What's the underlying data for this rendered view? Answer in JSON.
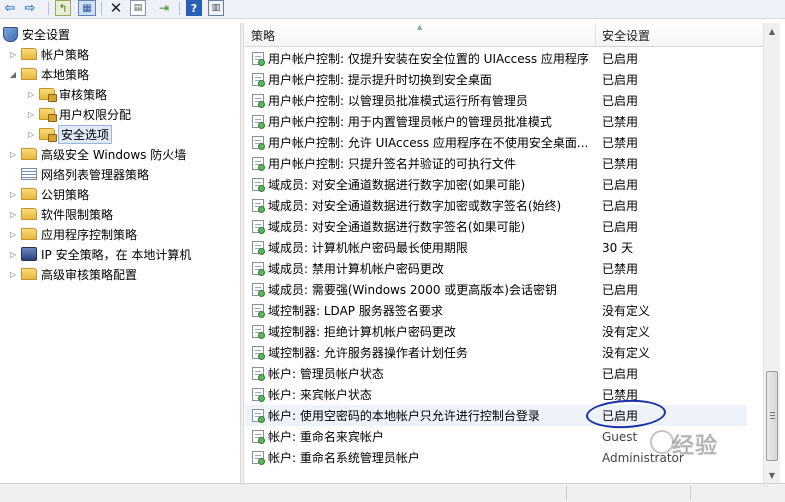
{
  "toolbar": {
    "icons": [
      "back-arrow-icon",
      "forward-arrow-icon",
      "up-folder-icon",
      "show-hide-tree-icon",
      "delete-icon",
      "properties-icon",
      "export-list-icon",
      "help-icon",
      "show-hide-action-pane-icon"
    ],
    "back_glyph": "⇦",
    "forward_glyph": "⇨",
    "up_glyph": "↰",
    "view_glyph": "▦",
    "delete_glyph": "✕",
    "properties_glyph": "▤",
    "export_glyph": "⇥",
    "help_glyph": "?",
    "panel_glyph": "▥"
  },
  "tree": {
    "nodes": [
      {
        "label": "安全设置",
        "icon": "security-settings-icon",
        "arrow": "◢",
        "expanded": true
      },
      {
        "label": "帐户策略",
        "icon": "folder-icon",
        "arrow": "▷"
      },
      {
        "label": "本地策略",
        "icon": "folder-icon",
        "arrow": "◢",
        "expanded": true
      },
      {
        "label": "审核策略",
        "icon": "locked-folder-icon",
        "arrow": "▷"
      },
      {
        "label": "用户权限分配",
        "icon": "locked-folder-icon",
        "arrow": "▷"
      },
      {
        "label": "安全选项",
        "icon": "locked-folder-icon",
        "arrow": "▷",
        "selected": true
      },
      {
        "label": "高级安全 Windows 防火墙",
        "icon": "folder-icon",
        "arrow": "▷"
      },
      {
        "label": "网络列表管理器策略",
        "icon": "network-list-icon",
        "arrow": ""
      },
      {
        "label": "公钥策略",
        "icon": "folder-icon",
        "arrow": "▷"
      },
      {
        "label": "软件限制策略",
        "icon": "folder-icon",
        "arrow": "▷"
      },
      {
        "label": "应用程序控制策略",
        "icon": "folder-icon",
        "arrow": "▷"
      },
      {
        "label": "IP 安全策略，在 本地计算机",
        "icon": "ip-security-icon",
        "arrow": "▷"
      },
      {
        "label": "高级审核策略配置",
        "icon": "folder-icon",
        "arrow": "▷"
      }
    ]
  },
  "list": {
    "headers": {
      "policy": "策略",
      "setting": "安全设置"
    },
    "sort_glyph": "▲",
    "rows": [
      {
        "policy": "用户帐户控制: 仅提升安装在安全位置的 UIAccess 应用程序",
        "setting": "已启用"
      },
      {
        "policy": "用户帐户控制: 提示提升时切换到安全桌面",
        "setting": "已启用"
      },
      {
        "policy": "用户帐户控制: 以管理员批准模式运行所有管理员",
        "setting": "已启用"
      },
      {
        "policy": "用户帐户控制: 用于内置管理员帐户的管理员批准模式",
        "setting": "已禁用"
      },
      {
        "policy": "用户帐户控制: 允许 UIAccess 应用程序在不使用安全桌面...",
        "setting": "已禁用"
      },
      {
        "policy": "用户帐户控制: 只提升签名并验证的可执行文件",
        "setting": "已禁用"
      },
      {
        "policy": "域成员: 对安全通道数据进行数字加密(如果可能)",
        "setting": "已启用"
      },
      {
        "policy": "域成员: 对安全通道数据进行数字加密或数字签名(始终)",
        "setting": "已启用"
      },
      {
        "policy": "域成员: 对安全通道数据进行数字签名(如果可能)",
        "setting": "已启用"
      },
      {
        "policy": "域成员: 计算机帐户密码最长使用期限",
        "setting": "30 天"
      },
      {
        "policy": "域成员: 禁用计算机帐户密码更改",
        "setting": "已禁用"
      },
      {
        "policy": "域成员: 需要强(Windows 2000 或更高版本)会话密钥",
        "setting": "已启用"
      },
      {
        "policy": "域控制器: LDAP 服务器签名要求",
        "setting": "没有定义"
      },
      {
        "policy": "域控制器: 拒绝计算机帐户密码更改",
        "setting": "没有定义"
      },
      {
        "policy": "域控制器: 允许服务器操作者计划任务",
        "setting": "没有定义"
      },
      {
        "policy": "帐户: 管理员帐户状态",
        "setting": "已启用"
      },
      {
        "policy": "帐户: 来宾帐户状态",
        "setting": "已禁用"
      },
      {
        "policy": "帐户: 使用空密码的本地帐户只允许进行控制台登录",
        "setting": "已启用",
        "highlight": true
      },
      {
        "policy": "帐户: 重命名来宾帐户",
        "setting": "Guest"
      },
      {
        "policy": "帐户: 重命名系统管理员帐户",
        "setting": "Administrator"
      }
    ]
  },
  "scrollbar": {
    "up_glyph": "▲",
    "down_glyph": "▼"
  },
  "watermark": {
    "text": "经验"
  },
  "colors": {
    "annotation": "#1a2fa8",
    "selection": "#dfe9f7"
  }
}
